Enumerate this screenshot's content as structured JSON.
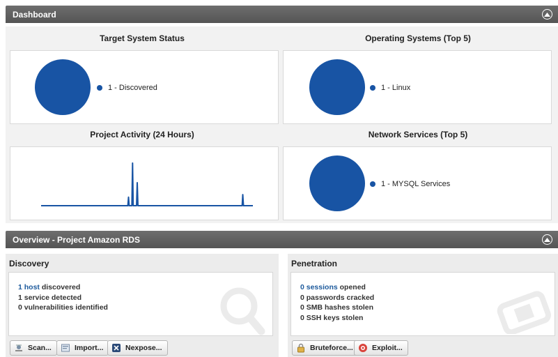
{
  "dashboard": {
    "title": "Dashboard",
    "charts": {
      "target_status": {
        "title": "Target System Status",
        "legend": [
          "1 - Discovered"
        ]
      },
      "operating_systems": {
        "title": "Operating Systems (Top 5)",
        "legend": [
          "1 - Linux"
        ]
      },
      "project_activity": {
        "title": "Project Activity (24 Hours)"
      },
      "network_services": {
        "title": "Network Services (Top 5)",
        "legend": [
          "1 - MYSQL Services"
        ]
      }
    }
  },
  "overview": {
    "title": "Overview - Project Amazon RDS",
    "discovery": {
      "title": "Discovery",
      "host_count": "1 host",
      "host_suffix": " discovered",
      "services": "1 service detected",
      "vulns": "0 vulnerabilities identified",
      "buttons": {
        "scan": "Scan...",
        "import": "Import...",
        "nexpose": "Nexpose..."
      }
    },
    "penetration": {
      "title": "Penetration",
      "sessions_count": "0 sessions",
      "sessions_suffix": " opened",
      "passwords": "0 passwords cracked",
      "smb": "0 SMB hashes stolen",
      "ssh": "0 SSH keys stolen",
      "buttons": {
        "bruteforce": "Bruteforce...",
        "exploit": "Exploit..."
      }
    }
  },
  "colors": {
    "accent": "#1854a4",
    "header_bar": "#5f5f5f",
    "link": "#1d5a9c"
  },
  "chart_data": [
    {
      "type": "pie",
      "title": "Target System Status",
      "categories": [
        "Discovered"
      ],
      "values": [
        1
      ]
    },
    {
      "type": "pie",
      "title": "Operating Systems (Top 5)",
      "categories": [
        "Linux"
      ],
      "values": [
        1
      ]
    },
    {
      "type": "line",
      "title": "Project Activity (24 Hours)",
      "values": [
        0,
        0,
        0,
        0,
        0,
        0,
        0,
        0,
        0,
        0,
        0,
        0,
        0,
        0,
        0,
        0,
        0,
        0,
        0,
        0,
        0,
        0,
        0,
        0,
        0,
        0,
        0,
        0,
        0,
        0,
        0,
        0,
        0,
        0,
        0,
        0,
        0,
        0,
        0,
        0,
        0,
        0,
        0,
        0,
        0,
        0,
        0,
        0,
        0,
        0,
        0,
        0,
        0,
        0,
        0,
        0,
        0,
        0,
        0,
        0,
        0,
        0,
        0,
        0,
        0,
        0,
        0,
        0,
        0,
        0,
        0,
        0,
        0,
        0,
        0,
        0,
        0,
        0,
        0,
        0,
        0,
        0,
        0,
        0,
        0,
        0,
        0,
        0,
        0,
        0,
        0,
        0,
        0,
        0,
        0,
        0,
        0,
        0,
        0,
        0,
        0,
        0,
        0,
        0,
        0,
        0,
        0,
        0,
        0,
        0,
        0,
        0,
        0,
        0,
        0,
        0,
        0,
        0,
        0,
        0,
        0,
        0,
        0,
        0,
        0,
        0,
        0,
        0,
        0,
        0,
        0,
        0,
        0,
        0,
        0,
        0,
        0,
        0,
        0,
        0,
        0,
        0,
        0,
        0,
        0,
        0,
        0,
        0,
        0,
        0,
        0,
        0,
        0,
        0,
        0,
        0,
        0,
        0,
        0,
        0,
        0,
        0,
        0,
        0,
        0,
        0,
        0,
        0,
        0,
        0,
        0,
        0,
        0,
        0,
        0,
        0,
        0,
        0,
        0,
        0,
        0,
        0,
        0,
        0,
        0,
        0,
        0,
        0,
        0,
        0,
        0,
        0,
        0,
        0,
        0,
        0,
        0,
        0,
        0,
        0,
        0,
        0,
        0,
        0,
        0,
        0,
        0,
        0,
        0,
        0,
        0,
        0,
        0,
        0,
        0,
        0,
        0,
        0,
        0,
        0,
        0,
        0,
        0,
        0,
        0,
        0,
        0,
        0,
        0,
        0,
        0,
        0,
        0,
        0,
        0,
        0,
        0,
        0,
        0,
        0,
        0,
        0,
        0,
        0,
        0,
        0,
        0,
        0,
        0,
        0,
        0,
        0,
        0,
        0,
        0,
        0,
        0,
        0,
        0,
        0,
        0,
        0,
        0,
        0,
        0,
        0,
        0,
        0,
        0,
        0,
        0,
        0,
        0,
        0,
        0,
        0,
        0,
        0,
        0,
        0,
        0,
        0,
        0,
        0,
        0,
        0,
        0,
        0,
        0,
        0,
        0,
        0,
        0,
        0,
        0,
        0,
        0,
        0,
        0,
        0,
        0,
        0,
        0,
        0,
        0,
        0,
        0,
        0,
        0,
        0,
        0,
        0,
        0,
        0,
        0,
        0
      ],
      "spikes": [
        {
          "index": 130,
          "value": 1
        },
        {
          "index": 136,
          "value": 5
        },
        {
          "index": 143,
          "value": 2.7
        },
        {
          "index": 300,
          "value": 1.3
        }
      ],
      "ylim": [
        0,
        5.4
      ]
    },
    {
      "type": "pie",
      "title": "Network Services (Top 5)",
      "categories": [
        "MYSQL Services"
      ],
      "values": [
        1
      ]
    }
  ]
}
